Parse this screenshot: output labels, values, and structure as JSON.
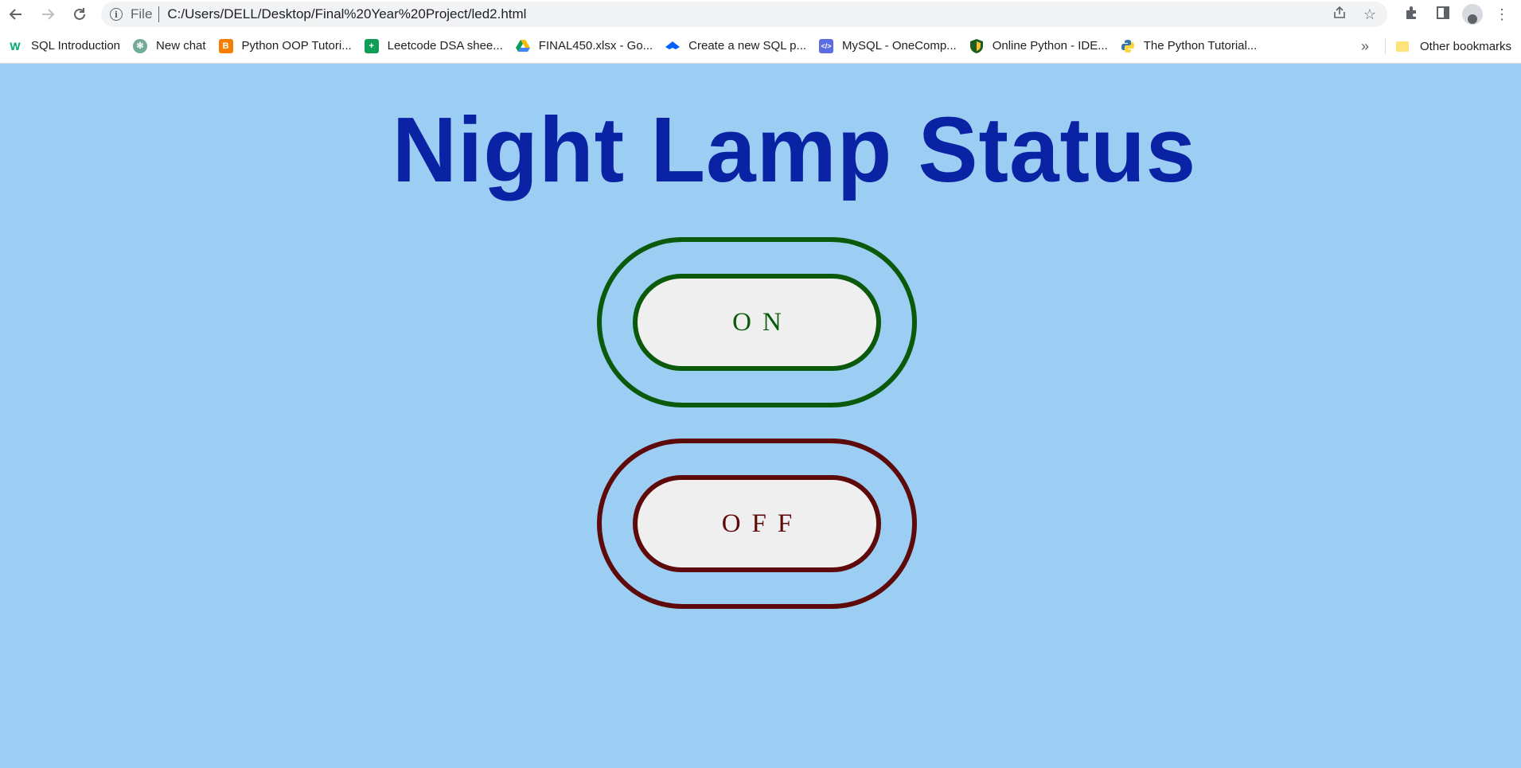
{
  "browser": {
    "scheme_label": "File",
    "url": "C:/Users/DELL/Desktop/Final%20Year%20Project/led2.html",
    "nav": {
      "back_icon": "arrow-left-icon",
      "forward_icon": "arrow-right-icon",
      "reload_icon": "reload-icon"
    }
  },
  "bookmarks": {
    "items": [
      {
        "label": "SQL Introduction",
        "icon": "w3schools-icon",
        "color": "#04aa6d"
      },
      {
        "label": "New chat",
        "icon": "chatgpt-icon",
        "color": "#74aa9c"
      },
      {
        "label": "Python OOP Tutori...",
        "icon": "blogger-icon",
        "color": "#f57d00"
      },
      {
        "label": "Leetcode DSA shee...",
        "icon": "sheets-icon",
        "color": "#0f9d58"
      },
      {
        "label": "FINAL450.xlsx - Go...",
        "icon": "drive-icon",
        "color": "#4285f4"
      },
      {
        "label": "Create a new SQL p...",
        "icon": "dropbox-icon",
        "color": "#0061ff"
      },
      {
        "label": "MySQL - OneComp...",
        "icon": "code-icon",
        "color": "#5b6ee1"
      },
      {
        "label": "Online Python - IDE...",
        "icon": "shield-icon",
        "color": "#2e7d32"
      },
      {
        "label": "The Python Tutorial...",
        "icon": "python-icon",
        "color": "#3776ab"
      }
    ],
    "more_label": "»",
    "other_label": "Other bookmarks"
  },
  "page": {
    "title": "Night Lamp Status",
    "on_label": "ON",
    "off_label": "OFF",
    "colors": {
      "background": "#9ccef4",
      "title": "#0a22a4",
      "on": "#0b5a0b",
      "off": "#5e0a0a",
      "button_fill": "#efefef"
    }
  }
}
